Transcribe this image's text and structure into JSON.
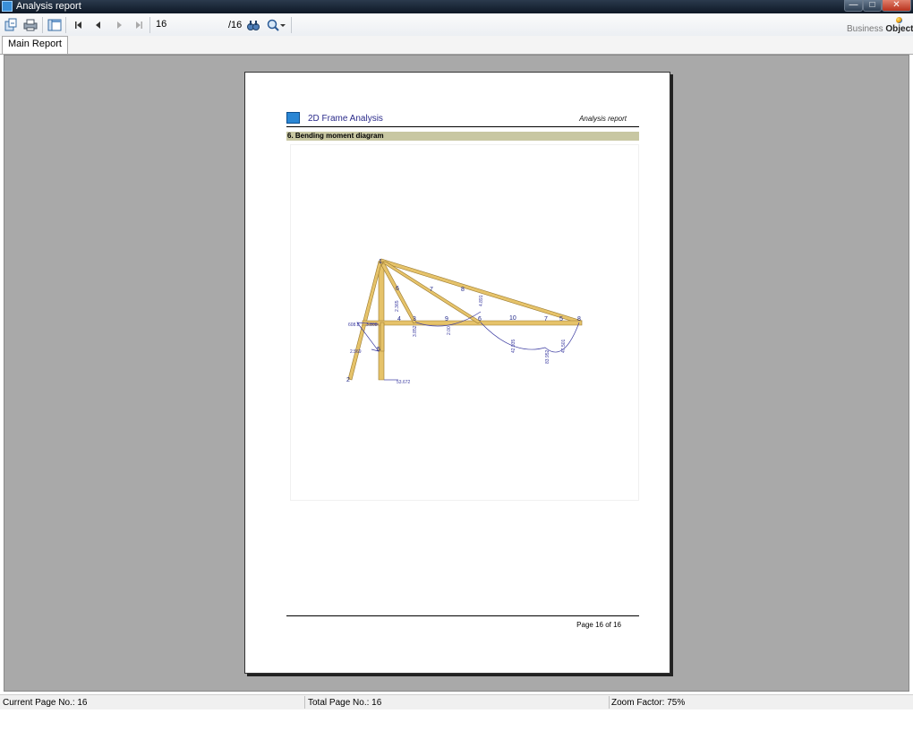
{
  "window": {
    "title": "Analysis report",
    "app_icon": "report-app-icon"
  },
  "toolbar": {
    "icons": [
      "export-icon",
      "print-icon",
      "group-tree-icon",
      "first-page-icon",
      "prev-page-icon",
      "next-page-icon",
      "last-page-icon",
      "search-icon",
      "zoom-icon",
      "dropdown-arrow-icon"
    ],
    "current_page_value": "16",
    "total_pages_label": "/16"
  },
  "brand": {
    "light": "Business ",
    "bold": "Objects"
  },
  "tabs": [
    {
      "label": "Main Report"
    }
  ],
  "report": {
    "title": "2D Frame Analysis",
    "subtitle": "Analysis report",
    "section_heading": "6. Bending moment diagram",
    "footer_page": "Page 16 of 16",
    "diagram": {
      "node_labels": [
        "1",
        "2",
        "3",
        "4",
        "5",
        "6",
        "7",
        "8",
        "9",
        "10",
        "7",
        "8",
        "6",
        "5"
      ],
      "moment_labels": [
        "608.8",
        "3.808",
        "2.569",
        "53.672",
        "2.365",
        "3.852",
        "2.00",
        "42.935",
        "83.952",
        "47.501",
        "4.891"
      ]
    }
  },
  "status": {
    "current_page": "Current Page No.: 16",
    "total_pages": "Total Page No.: 16",
    "zoom": "Zoom Factor: 75%"
  },
  "colors": {
    "titlebar": "#0e1826",
    "viewer_bg": "#a9a9a9",
    "section_bar": "#c8c7a2",
    "member_fill": "#e6c36a",
    "diagram_line": "#3a3aa0"
  }
}
